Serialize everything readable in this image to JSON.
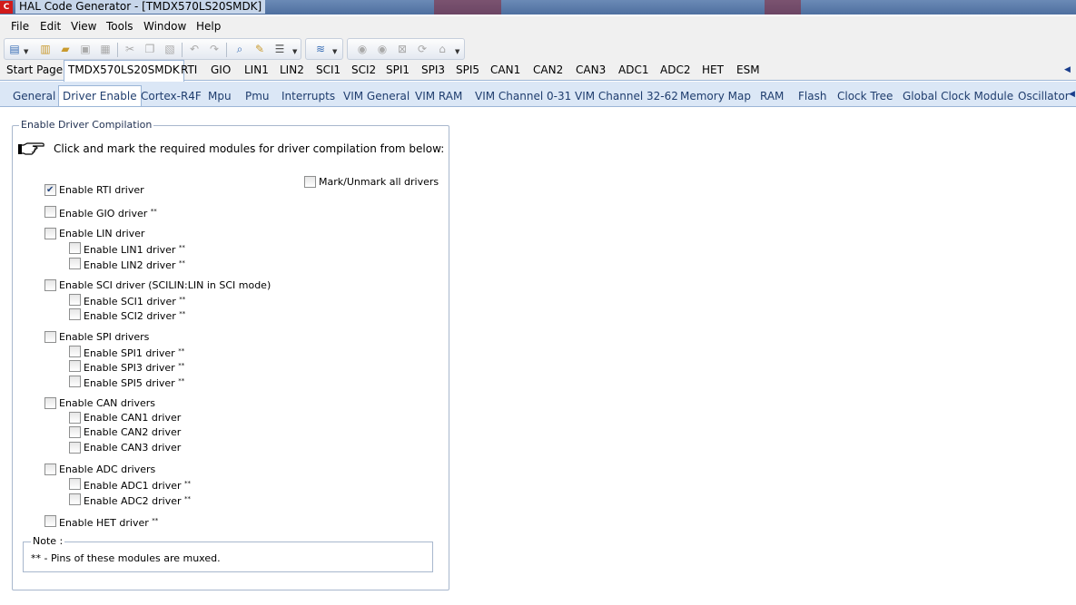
{
  "window": {
    "app_icon_text": "C",
    "title": "HAL Code Generator  - [TMDX570LS20SMDK]"
  },
  "menu": [
    "File",
    "Edit",
    "View",
    "Tools",
    "Window",
    "Help"
  ],
  "toolbar": {
    "buttons": [
      "new-project-icon",
      "open-icon",
      "open-folder-icon",
      "save-icon",
      "save-all-icon",
      "cut-icon",
      "copy-icon",
      "paste-icon",
      "undo-icon",
      "redo-icon",
      "find-icon",
      "find-replace-icon",
      "properties-icon",
      "generate-code-icon",
      "back-icon",
      "forward-icon",
      "stop-icon",
      "refresh-icon",
      "home-icon"
    ]
  },
  "top_tabs": {
    "items": [
      "Start Page",
      "TMDX570LS20SMDK",
      "RTI",
      "GIO",
      "LIN1",
      "LIN2",
      "SCI1",
      "SCI2",
      "SPI1",
      "SPI3",
      "SPI5",
      "CAN1",
      "CAN2",
      "CAN3",
      "ADC1",
      "ADC2",
      "HET",
      "ESM"
    ],
    "active_index": 1
  },
  "sub_tabs": {
    "items": [
      "General",
      "Driver Enable",
      "Cortex-R4F",
      "Mpu",
      "Pmu",
      "Interrupts",
      "VIM General",
      "VIM RAM",
      "VIM Channel 0-31",
      "VIM Channel 32-62",
      "Memory Map",
      "RAM",
      "Flash",
      "Clock Tree",
      "Global Clock Module",
      "Oscillator"
    ],
    "active_index": 1
  },
  "content": {
    "group_title": "Enable Driver Compilation",
    "instruction": "Click and mark the required modules for driver compilation from below:",
    "mark_all_label": "Mark/Unmark all drivers",
    "muxed_marker": "**",
    "checkboxes": [
      {
        "label": "Enable RTI driver",
        "checked": true,
        "muxed": false
      },
      {
        "label": "Enable GIO driver",
        "checked": false,
        "muxed": true
      },
      {
        "label": "Enable LIN driver",
        "checked": false,
        "muxed": false
      },
      {
        "label": "Enable LIN1 driver",
        "checked": false,
        "muxed": true
      },
      {
        "label": "Enable LIN2 driver",
        "checked": false,
        "muxed": true
      },
      {
        "label": "Enable SCI driver (SCILIN:LIN in SCI mode)",
        "checked": false,
        "muxed": false
      },
      {
        "label": "Enable SCI1 driver",
        "checked": false,
        "muxed": true
      },
      {
        "label": "Enable SCI2 driver",
        "checked": false,
        "muxed": true
      },
      {
        "label": "Enable SPI drivers",
        "checked": false,
        "muxed": false
      },
      {
        "label": "Enable SPI1 driver",
        "checked": false,
        "muxed": true
      },
      {
        "label": "Enable SPI3 driver",
        "checked": false,
        "muxed": true
      },
      {
        "label": "Enable SPI5 driver",
        "checked": false,
        "muxed": true
      },
      {
        "label": "Enable CAN drivers",
        "checked": false,
        "muxed": false
      },
      {
        "label": "Enable CAN1 driver",
        "checked": false,
        "muxed": false
      },
      {
        "label": "Enable CAN2 driver",
        "checked": false,
        "muxed": false
      },
      {
        "label": "Enable CAN3 driver",
        "checked": false,
        "muxed": false
      },
      {
        "label": "Enable ADC drivers",
        "checked": false,
        "muxed": false
      },
      {
        "label": "Enable ADC1 driver",
        "checked": false,
        "muxed": true
      },
      {
        "label": "Enable ADC2 driver",
        "checked": false,
        "muxed": true
      },
      {
        "label": "Enable HET driver",
        "checked": false,
        "muxed": true
      }
    ],
    "note_title": "Note :",
    "note_text": "** - Pins of these modules are muxed."
  },
  "colors": {
    "active_tab_border": "#9cb6d7",
    "sub_tab_strip": "#dbe7f6",
    "sub_tab_text": "#1f3d6e"
  }
}
